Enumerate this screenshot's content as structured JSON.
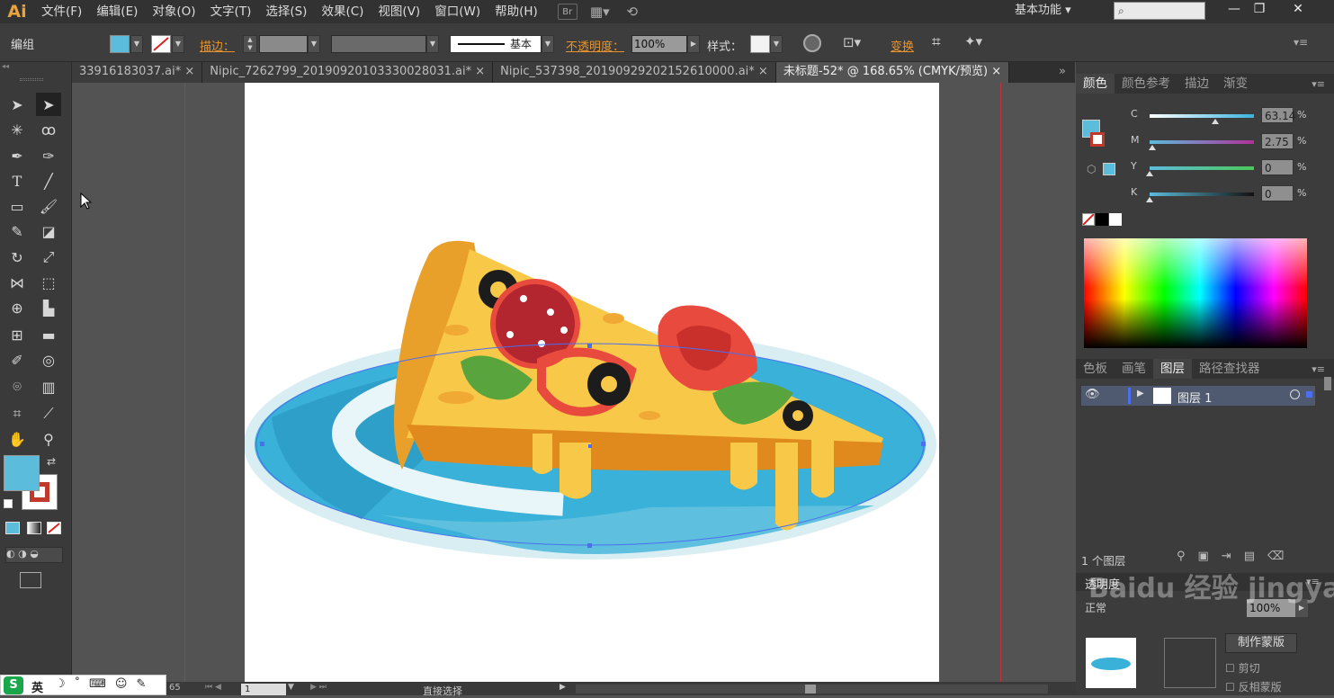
{
  "app": {
    "logo": "Ai"
  },
  "menu": [
    "文件(F)",
    "编辑(E)",
    "对象(O)",
    "文字(T)",
    "选择(S)",
    "效果(C)",
    "视图(V)",
    "窗口(W)",
    "帮助(H)"
  ],
  "menubar_icons": {
    "bridge": "Br"
  },
  "workspace": {
    "label": "基本功能"
  },
  "window_buttons": {
    "minimize": "—",
    "restore": "❐",
    "close": "✕"
  },
  "control_bar": {
    "selection_type": "编组",
    "stroke_label": "描边：",
    "brush_profile": "基本",
    "opacity_label": "不透明度：",
    "opacity_value": "100%",
    "style_label": "样式：",
    "transform_label": "变换",
    "fill_color": "#5bbcdc"
  },
  "tabs": [
    {
      "label": "33916183037.ai*",
      "close": "×"
    },
    {
      "label": "Nipic_7262799_20190920103330028031.ai*",
      "close": "×"
    },
    {
      "label": "Nipic_537398_20190929202152610000.ai*",
      "close": "×"
    },
    {
      "label": "未标题-52* @ 168.65% (CMYK/预览)",
      "close": "×"
    }
  ],
  "color_panel": {
    "tabs": [
      "颜色",
      "颜色参考",
      "描边",
      "渐变"
    ],
    "channels": [
      {
        "name": "C",
        "value": "63.14",
        "unit": "%",
        "fraction": 0.63,
        "track": "#3ab3df"
      },
      {
        "name": "M",
        "value": "2.75",
        "unit": "%",
        "fraction": 0.03,
        "track": "#b0309a"
      },
      {
        "name": "Y",
        "value": "0",
        "unit": "%",
        "fraction": 0.0,
        "track": "#d8d83a"
      },
      {
        "name": "K",
        "value": "0",
        "unit": "%",
        "fraction": 0.0,
        "track": "#444444"
      }
    ]
  },
  "layers_panel": {
    "tabs": [
      "色板",
      "画笔",
      "图层",
      "路径查找器"
    ],
    "layer_name": "图层 1",
    "count": "1 个图层"
  },
  "transparency_panel": {
    "title": "透明度",
    "mode": "正常",
    "opacity": "100%",
    "make_mask": "制作蒙版",
    "clip": "剪切",
    "invert_mask": "反相蒙版"
  },
  "status": {
    "ime": "英",
    "zoom": "65",
    "page": "1",
    "tool_name": "直接选择"
  },
  "watermark": "Baidu 经验 jingyan.baidu"
}
